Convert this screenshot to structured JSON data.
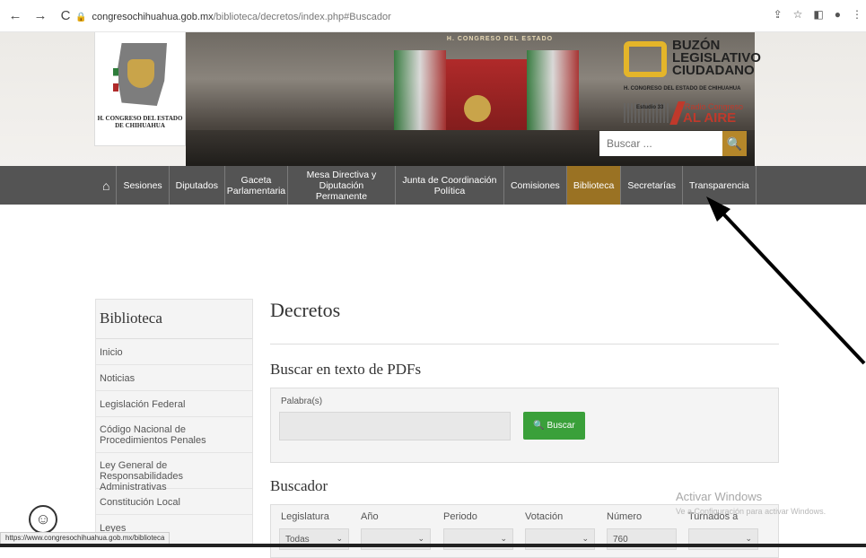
{
  "browser": {
    "back": "←",
    "forward": "→",
    "reload": "C",
    "url_host": "congresochihuahua.gob.mx",
    "url_path": "/biblioteca/decretos/index.php#Buscador",
    "icons": [
      "share-icon",
      "star-icon",
      "panel-icon",
      "profile-icon",
      "menu-icon"
    ]
  },
  "header": {
    "logo_text": "H. CONGRESO DEL ESTADO DE CHIHUAHUA",
    "photo_banner": "H. CONGRESO DEL ESTADO",
    "buzon_title": [
      "BUZÓN",
      "LEGISLATIVO",
      "CIUDADANO"
    ],
    "buzon_sub": "H. CONGRESO DEL ESTADO DE CHIHUAHUA",
    "radio_estudio": "Estudio 33",
    "radio_name": "Radio Congreso",
    "radio_al_aire": "AL AIRE",
    "search_placeholder": "Buscar ..."
  },
  "menu": {
    "items": [
      {
        "label": "Sesiones"
      },
      {
        "label": "Diputados"
      },
      {
        "label": "Gaceta Parlamentaria"
      },
      {
        "label": "Mesa Directiva y Diputación Permanente"
      },
      {
        "label": "Junta de Coordinación Política"
      },
      {
        "label": "Comisiones"
      },
      {
        "label": "Biblioteca",
        "active": true
      },
      {
        "label": "Secretarías"
      },
      {
        "label": "Transparencia"
      }
    ]
  },
  "sidebar": {
    "title": "Biblioteca",
    "items": [
      "Inicio",
      "Noticias",
      "Legislación Federal",
      "Código Nacional de Procedimientos Penales",
      "Ley General de Responsabilidades Administrativas",
      "Constitución Local",
      "Leyes"
    ]
  },
  "main": {
    "title": "Decretos",
    "pdf_section": "Buscar en texto de PDFs",
    "word_label": "Palabra(s)",
    "search_button": "Buscar",
    "buscador_title": "Buscador",
    "filters": [
      {
        "label": "Legislatura",
        "value": "Todas"
      },
      {
        "label": "Año",
        "value": ""
      },
      {
        "label": "Periodo",
        "value": ""
      },
      {
        "label": "Votación",
        "value": ""
      },
      {
        "label": "Número",
        "value": "760"
      },
      {
        "label": "Turnados a",
        "value": ""
      }
    ]
  },
  "overlay": {
    "activate_title": "Activar Windows",
    "activate_sub": "Ve a Configuración para activar Windows.",
    "status_url": "https://www.congresochihuahua.gob.mx/biblioteca"
  }
}
